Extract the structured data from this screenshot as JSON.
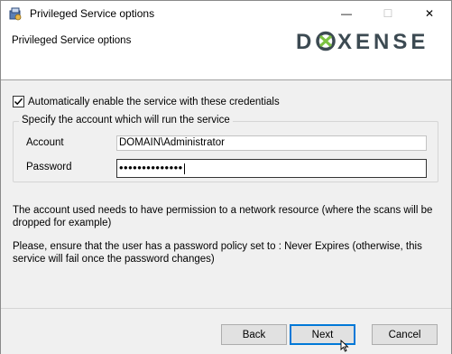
{
  "window": {
    "title": "Privileged Service options",
    "controls": {
      "minimize": "—",
      "maximize": "☐",
      "close": "✕"
    }
  },
  "header": {
    "title": "Privileged Service options",
    "logo_text": "DOXENSE",
    "logo_color": "#3c4a52",
    "logo_accent": "#7cc242"
  },
  "form": {
    "auto_enable_label": "Automatically enable the service with these credentials",
    "auto_enable_checked": true,
    "group_title": "Specify the account which will run the service",
    "account_label": "Account",
    "account_value": "DOMAIN\\Administrator",
    "password_label": "Password",
    "password_masked": "••••••••••••••"
  },
  "info": {
    "line1": "The account used needs to have permission to a network resource (where the scans will be dropped for example)",
    "line2": "Please, ensure that the user has a password policy set to : Never Expires (otherwise, this service will fail once the password changes)"
  },
  "buttons": {
    "back": "Back",
    "next": "Next",
    "cancel": "Cancel"
  }
}
